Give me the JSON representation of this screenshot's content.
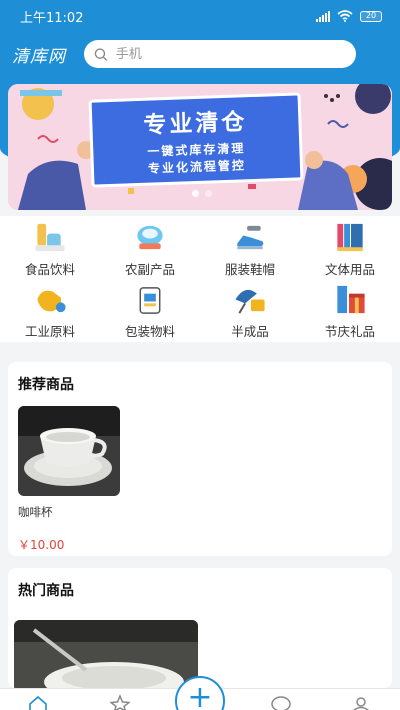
{
  "status_bar": {
    "time": "上午11:02",
    "battery": "20"
  },
  "header": {
    "logo": "清库网",
    "search_placeholder": "手机"
  },
  "banner": {
    "title": "专业清仓",
    "line1": "一键式库存清理",
    "line2": "专业化流程管控"
  },
  "categories": [
    {
      "label": "食品饮料",
      "icon": "food-drink-icon"
    },
    {
      "label": "农副产品",
      "icon": "farm-produce-icon"
    },
    {
      "label": "服装鞋帽",
      "icon": "apparel-shoes-icon"
    },
    {
      "label": "文体用品",
      "icon": "stationery-sports-icon"
    },
    {
      "label": "工业原料",
      "icon": "industrial-material-icon"
    },
    {
      "label": "包装物料",
      "icon": "packaging-icon"
    },
    {
      "label": "半成品",
      "icon": "semi-finished-icon"
    },
    {
      "label": "节庆礼品",
      "icon": "festival-gift-icon"
    }
  ],
  "recommended": {
    "title": "推荐商品",
    "products": [
      {
        "name": "咖啡杯",
        "price": "￥10.00"
      }
    ]
  },
  "hot": {
    "title": "热门商品"
  },
  "tabbar": {
    "tabs": [
      {
        "icon": "home-icon"
      },
      {
        "icon": "star-icon"
      },
      {
        "icon": "add-icon"
      },
      {
        "icon": "message-icon"
      },
      {
        "icon": "profile-icon"
      }
    ]
  },
  "colors": {
    "primary": "#1e8fd6",
    "price": "#e0443a",
    "banner_card": "#3c6ce0"
  }
}
